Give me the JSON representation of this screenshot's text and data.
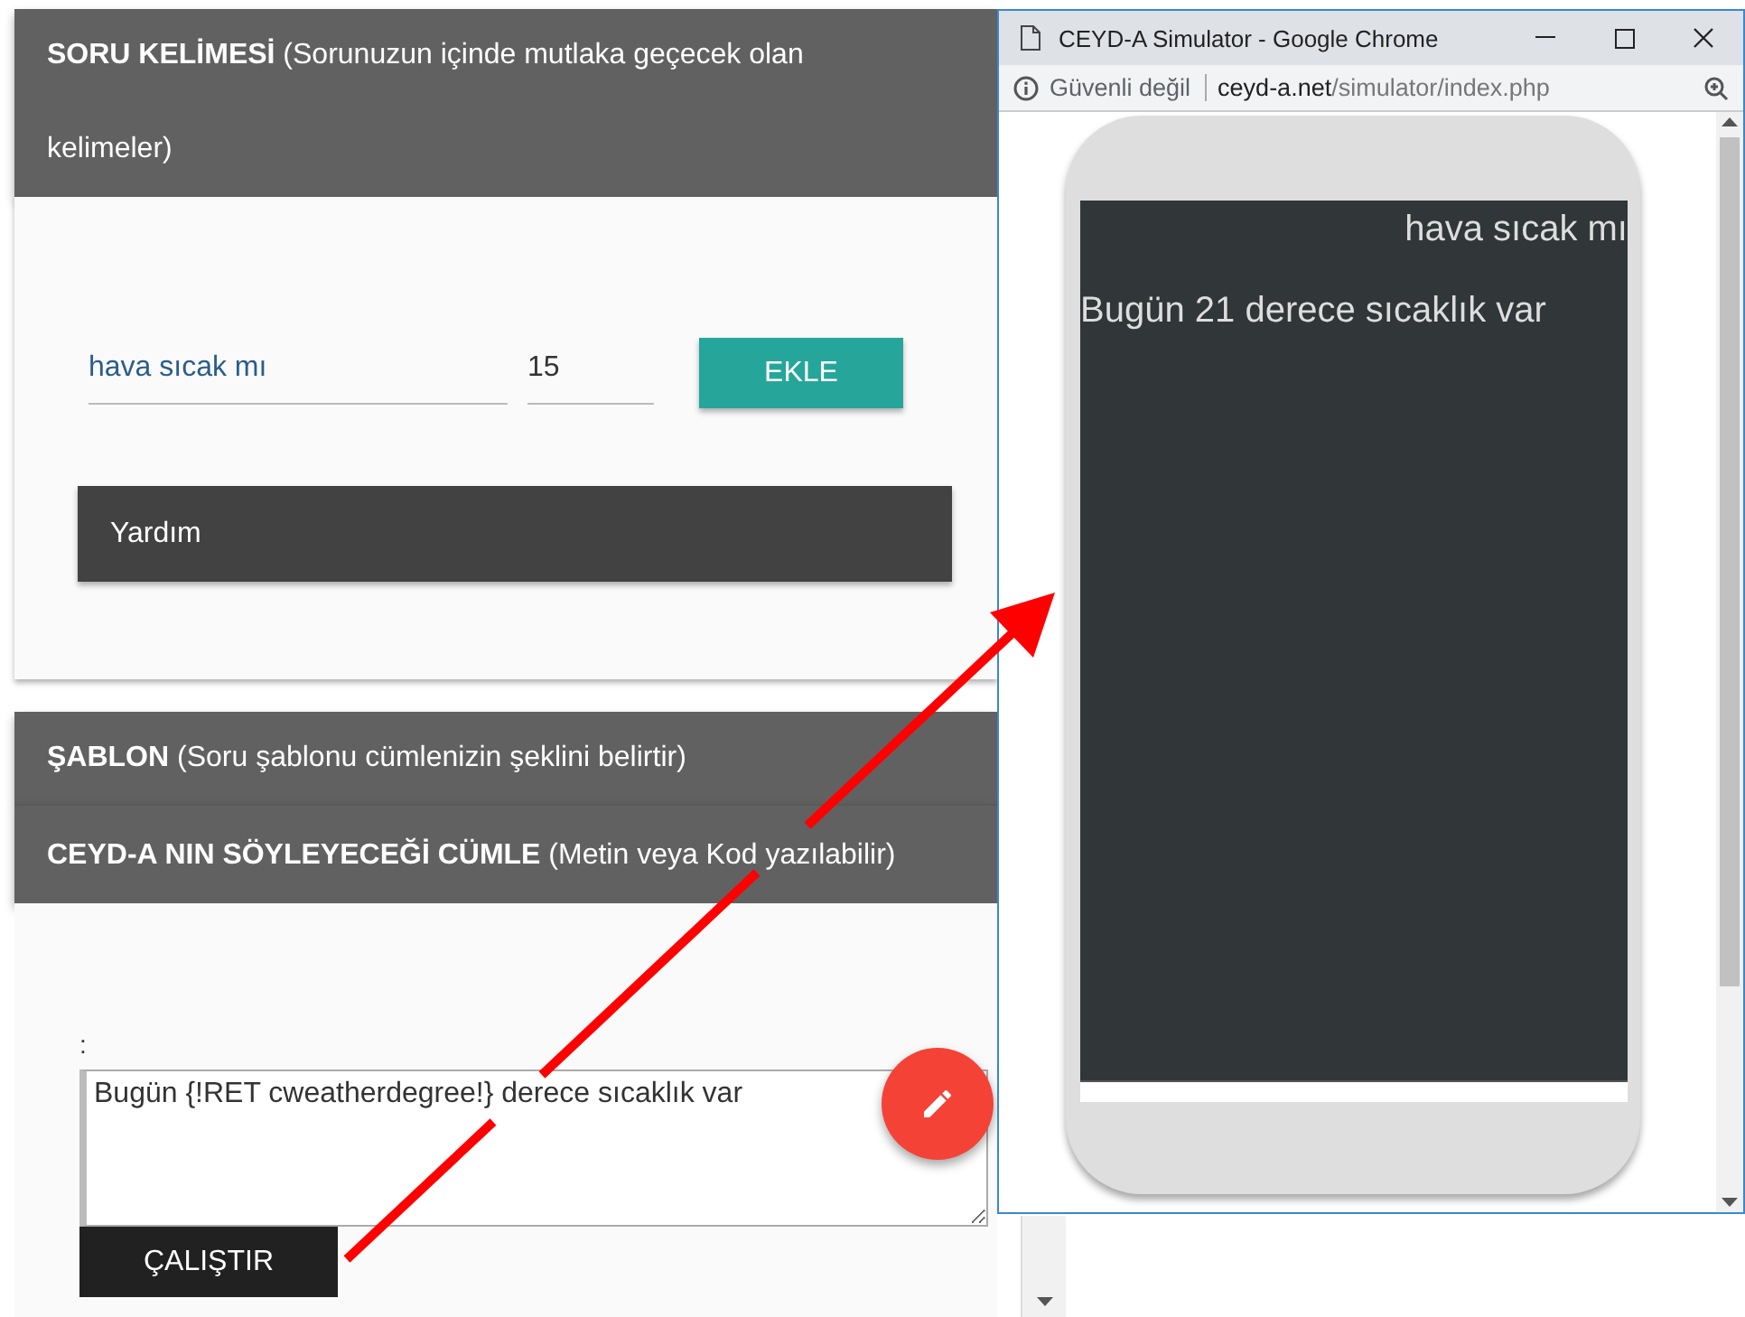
{
  "sections": [
    {
      "heading": "**SORU KELİMESİ** (Sorunuzun içinde mutlaka geçecek olan kelimeler)"
    },
    {
      "heading": "**ŞABLON** (Soru şablonu cümlenizin şeklini belirtir)"
    },
    {
      "heading": "**CEYD-A NIN SÖYLEYECEĞİ CÜMLE** (Metin veya Kod yazılabilir)"
    }
  ],
  "keyword": {
    "value": "hava sıcak mı"
  },
  "weight": {
    "value": "15"
  },
  "add_button": "EKLE",
  "help_bar": "Yardım",
  "sentence": {
    "label": ":",
    "value": "Bugün {!RET cweatherdegree!} derece sıcaklık var"
  },
  "run_button": "ÇALIŞTIR",
  "popup": {
    "title": "CEYD-A Simulator - Google Chrome",
    "security": "Güvenli değil",
    "url_host": "ceyd-a.net",
    "url_path": "/simulator/index.php",
    "messages": [
      {
        "kind": "user",
        "text": "hava sıcak mı"
      },
      {
        "kind": "bot",
        "text": "Bugün 21 derece sıcaklık var"
      }
    ]
  }
}
